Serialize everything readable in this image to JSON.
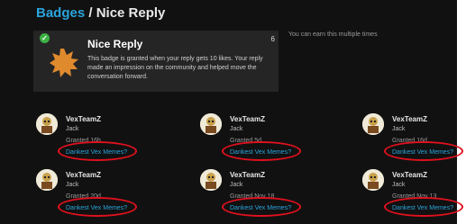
{
  "header": {
    "breadcrumb_link": "Badges",
    "separator": " / ",
    "title": "Nice Reply"
  },
  "badge": {
    "title": "Nice Reply",
    "description": "This badge is granted when your reply gets 10 likes. Your reply made an impression on the community and helped move the conversation forward.",
    "count": "6",
    "multiple_note": "You can earn this multiple times"
  },
  "colors": {
    "link": "#2aa4dc",
    "annotation": "#e2101e",
    "badge_icon": "#e08a2e",
    "check": "#3cb043"
  },
  "users": [
    {
      "username": "VexTeamZ",
      "name": "Jack",
      "granted": "Granted 16h",
      "topic": "Dankest Vex Memes?"
    },
    {
      "username": "VexTeamZ",
      "name": "Jack",
      "granted": "Granted 5d",
      "topic": "Dankest Vex Memes?"
    },
    {
      "username": "VexTeamZ",
      "name": "Jack",
      "granted": "Granted 16d",
      "topic": "Dankest Vex Memes?"
    },
    {
      "username": "VexTeamZ",
      "name": "Jack",
      "granted": "Granted 20d",
      "topic": "Dankest Vex Memes?"
    },
    {
      "username": "VexTeamZ",
      "name": "Jack",
      "granted": "Granted Nov 18",
      "topic": "Dankest Vex Memes?"
    },
    {
      "username": "VexTeamZ",
      "name": "Jack",
      "granted": "Granted Nov 13",
      "topic": "Dankest Vex Memes?"
    }
  ]
}
